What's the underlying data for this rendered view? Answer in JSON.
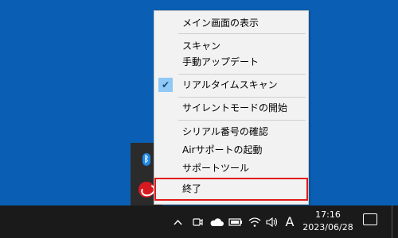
{
  "menu": {
    "items": [
      {
        "label": "メイン画面の表示"
      },
      {
        "label": "スキャン"
      },
      {
        "label": "手動アップデート"
      },
      {
        "label": "リアルタイムスキャン",
        "checked": true
      },
      {
        "label": "サイレントモードの開始"
      },
      {
        "label": "シリアル番号の確認"
      },
      {
        "label": "Airサポートの起動"
      },
      {
        "label": "サポートツール"
      },
      {
        "label": "終了",
        "highlighted": true
      }
    ],
    "check_icon": "check-icon",
    "highlight_color": "#e11a1a",
    "check_bg_color": "#90c8f6"
  },
  "tray_overflow": {
    "icons": [
      "bluetooth-icon",
      "trend-micro-icon"
    ]
  },
  "taskbar": {
    "icons": [
      "chevron-up-icon",
      "meet-now-icon",
      "onedrive-cloud-icon",
      "battery-icon",
      "wifi-icon",
      "volume-icon"
    ],
    "ime_label": "A",
    "time": "17:16",
    "date": "2023/06/28",
    "notification_icon": "notification-icon"
  },
  "colors": {
    "desktop": "#0a5fb4",
    "taskbar": "#1a1a1a",
    "menu_bg": "#f2f2f2"
  }
}
